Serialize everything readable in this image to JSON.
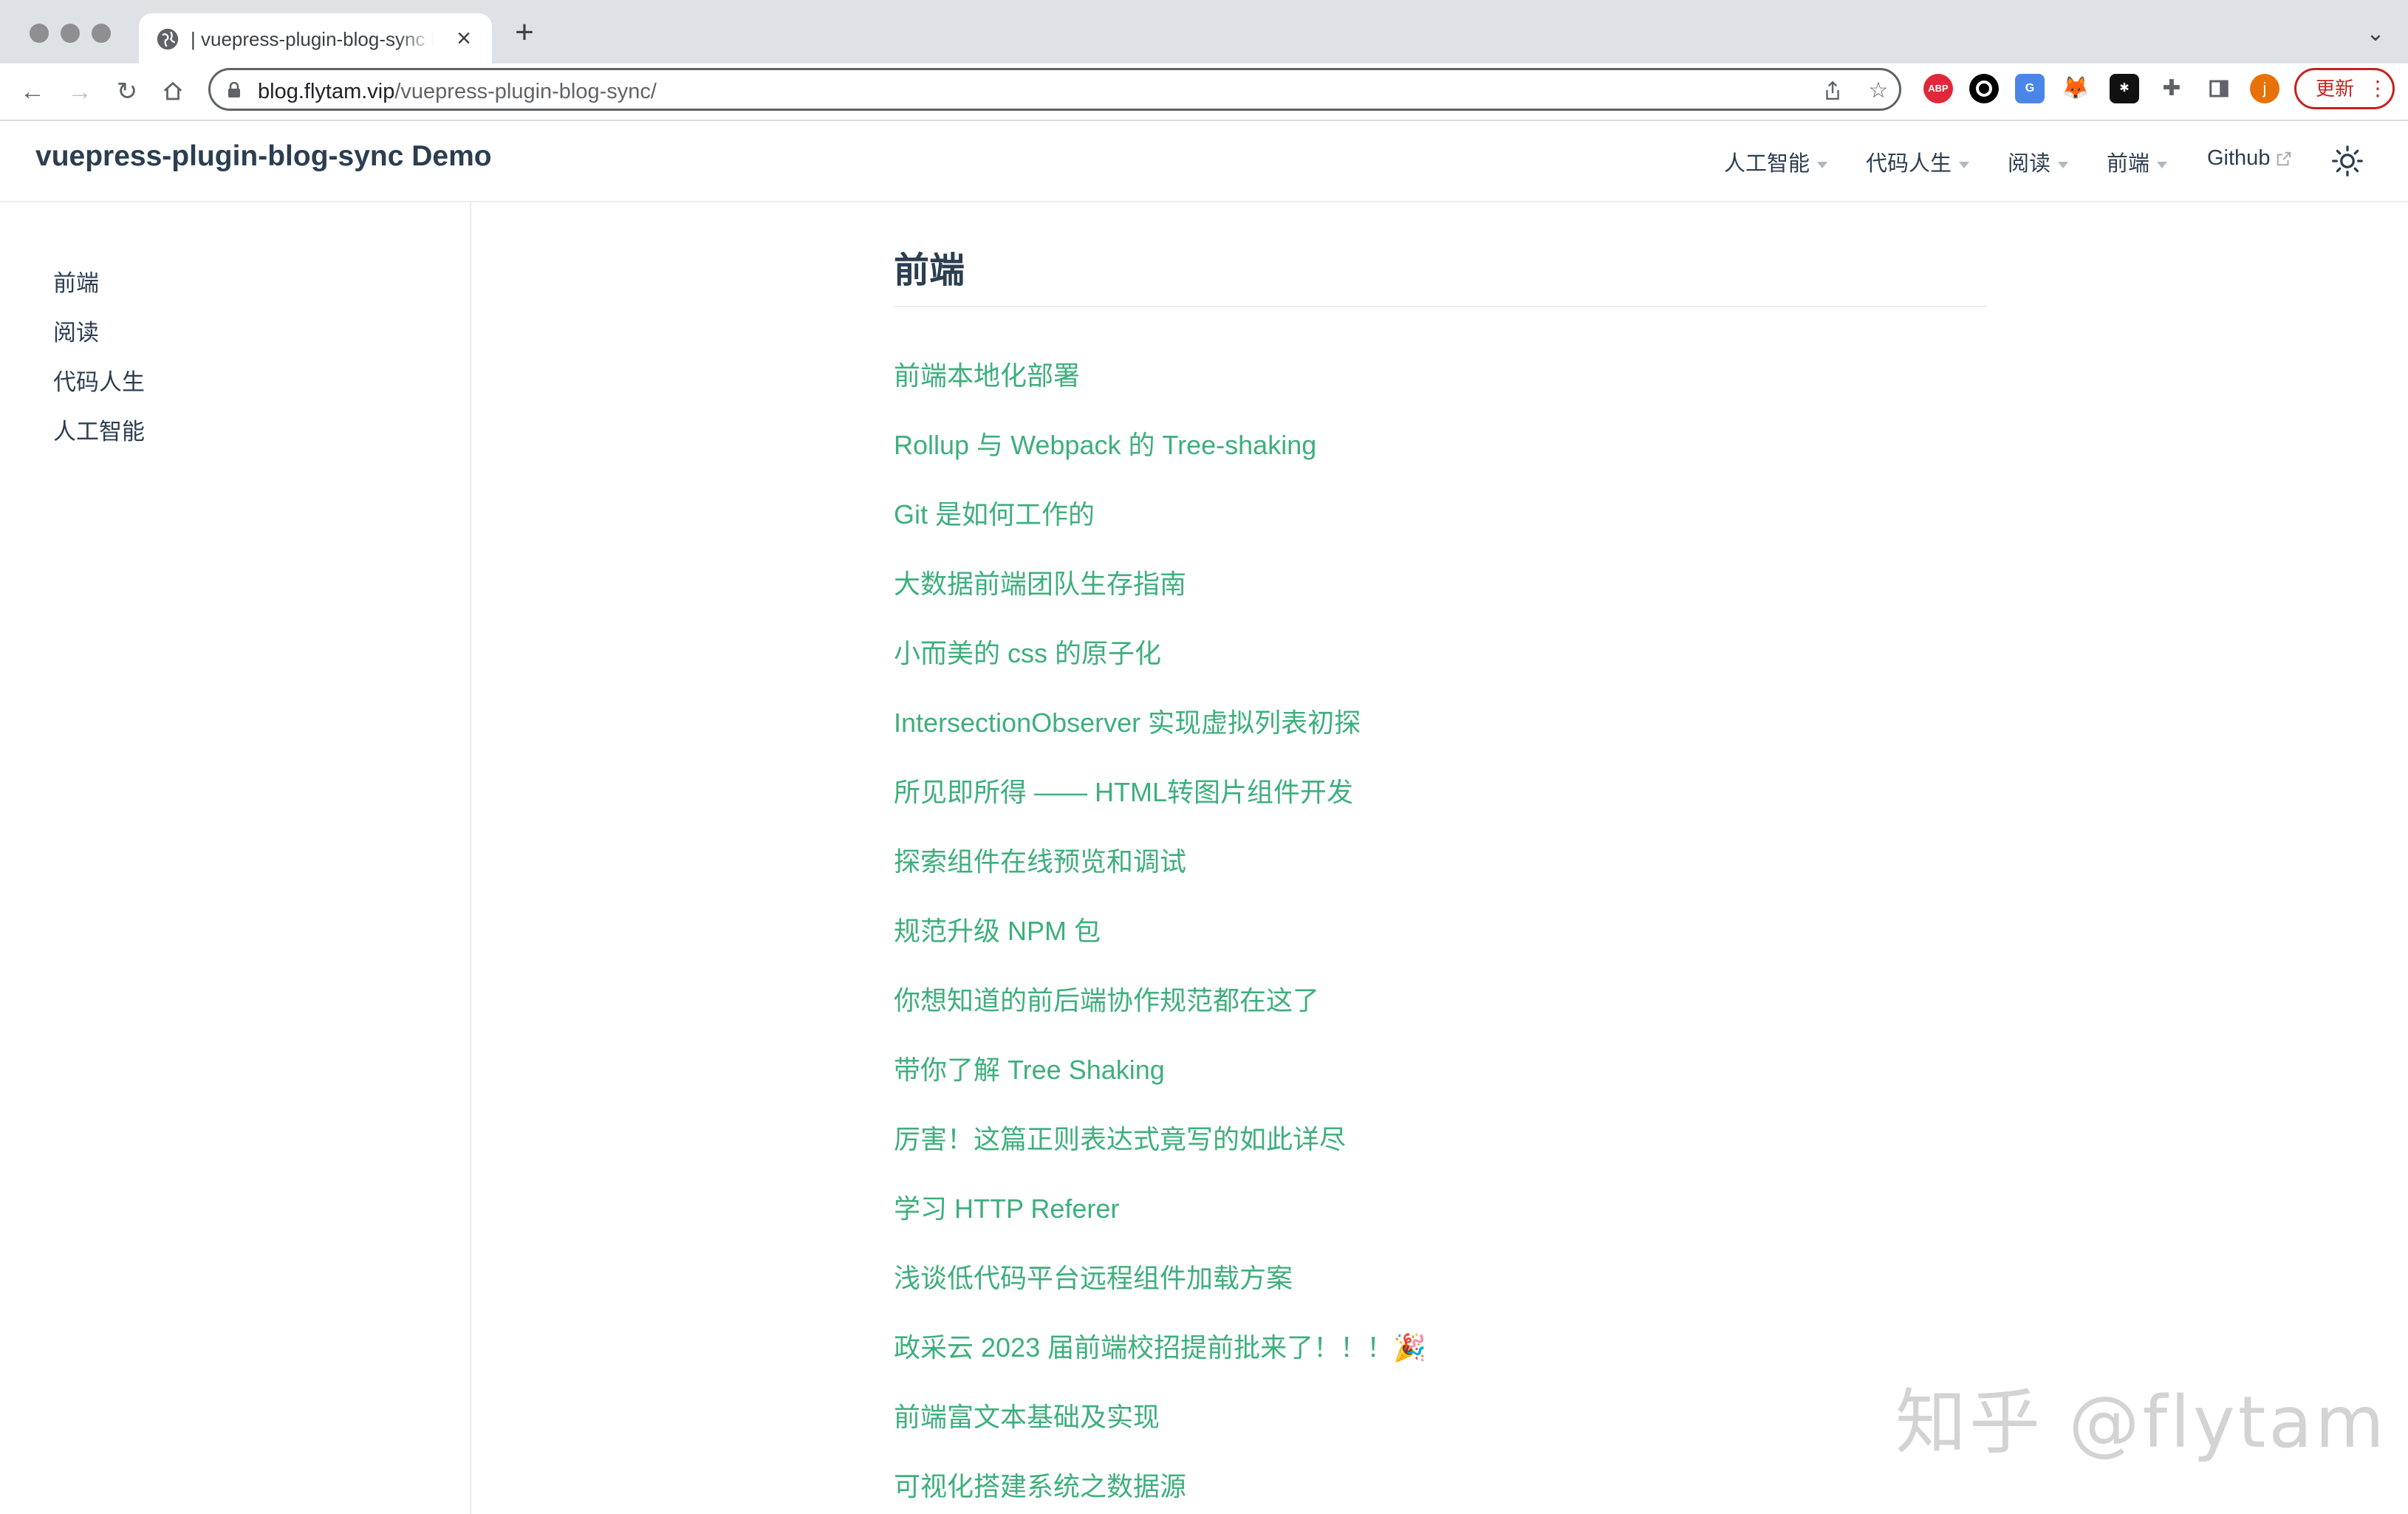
{
  "browser": {
    "tab_title": "| vuepress-plugin-blog-sync Demo",
    "new_tab": "+",
    "close": "×",
    "url_host": "blog.flytam.vip",
    "url_path": "/vuepress-plugin-blog-sync/",
    "update_label": "更新",
    "update_more": "⋮",
    "extensions": [
      "abp",
      "circle",
      "translate",
      "fox",
      "grid",
      "puzzle",
      "sidepanel",
      "profile"
    ],
    "profile_initial": "j",
    "abp_label": "ABP"
  },
  "site": {
    "brand": "vuepress-plugin-blog-sync Demo",
    "nav": [
      {
        "label": "人工智能",
        "dropdown": true
      },
      {
        "label": "代码人生",
        "dropdown": true
      },
      {
        "label": "阅读",
        "dropdown": true
      },
      {
        "label": "前端",
        "dropdown": true
      },
      {
        "label": "Github",
        "external": true
      }
    ]
  },
  "sidebar": {
    "items": [
      "前端",
      "阅读",
      "代码人生",
      "人工智能"
    ]
  },
  "main": {
    "title": "前端",
    "articles": [
      "前端本地化部署",
      "Rollup 与 Webpack 的 Tree-shaking",
      "Git 是如何工作的",
      "大数据前端团队生存指南",
      "小而美的 css 的原子化",
      "IntersectionObserver 实现虚拟列表初探",
      "所见即所得 —— HTML转图片组件开发",
      "探索组件在线预览和调试",
      "规范升级 NPM 包",
      "你想知道的前后端协作规范都在这了",
      "带你了解 Tree Shaking",
      "厉害！这篇正则表达式竟写的如此详尽",
      "学习 HTTP Referer",
      "浅谈低代码平台远程组件加载方案",
      "政采云 2023 届前端校招提前批来了！！！🎉",
      "前端富文本基础及实现",
      "可视化搭建系统之数据源"
    ]
  },
  "watermark": "知乎 @flytam",
  "colors": {
    "link": "#3eaf7c",
    "text": "#2c3e50",
    "border": "#eaecef",
    "update": "#c5221f"
  }
}
